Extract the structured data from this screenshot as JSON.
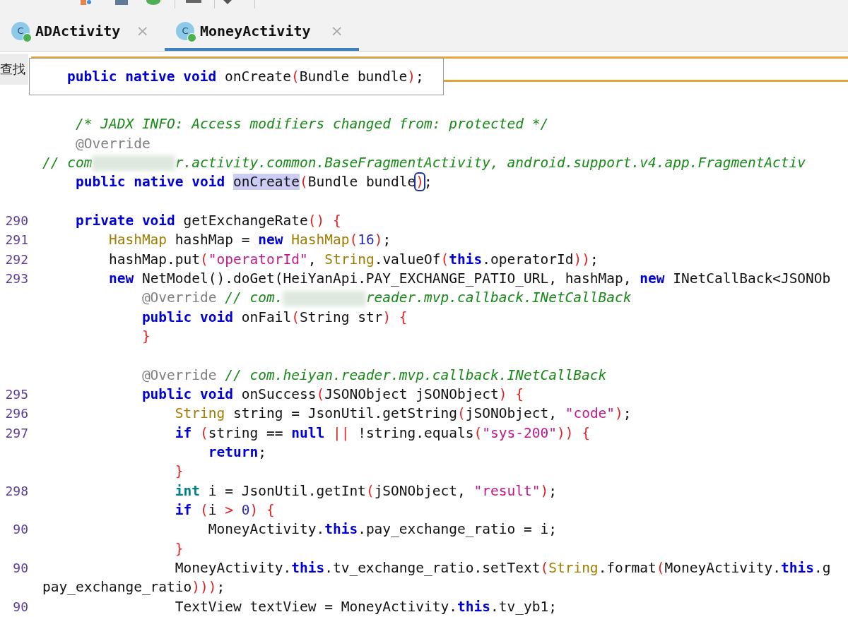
{
  "tabs": [
    {
      "label": "ADActivity",
      "icon_letter": "C",
      "close": "×",
      "selected": false
    },
    {
      "label": "MoneyActivity",
      "icon_letter": "C",
      "close": "×",
      "selected": true
    }
  ],
  "search": {
    "label": "查找"
  },
  "tooltip": {
    "tokens": [
      {
        "kind": "keyword",
        "text": "    public native void "
      },
      {
        "kind": "plain",
        "text": "onCreate"
      },
      {
        "kind": "punct",
        "text": "("
      },
      {
        "kind": "plain",
        "text": "Bundle bundle"
      },
      {
        "kind": "punct",
        "text": ")"
      },
      {
        "kind": "plain",
        "text": ";"
      }
    ]
  },
  "code_lines": [
    {
      "kind": "code",
      "tokens": [
        {
          "kind": "comment",
          "text": "    /* JADX INFO: Access modifiers changed from: protected */"
        }
      ]
    },
    {
      "kind": "code",
      "tokens": [
        {
          "kind": "annotation",
          "text": "    @Override"
        }
      ]
    },
    {
      "kind": "code",
      "tokens": [
        {
          "kind": "comment",
          "text": "// com"
        },
        {
          "kind": "redacted"
        },
        {
          "kind": "comment",
          "text": "r.activity.common.BaseFragmentActivity, android.support.v4.app.FragmentActiv"
        }
      ]
    },
    {
      "kind": "code",
      "tokens": [
        {
          "kind": "keyword",
          "text": "    public native void "
        },
        {
          "kind": "highlight",
          "text": "onCreate"
        },
        {
          "kind": "punct",
          "text": "("
        },
        {
          "kind": "plain",
          "text": "Bundle bundle"
        },
        {
          "kind": "matched",
          "text": ")"
        },
        {
          "kind": "plain",
          "text": ";"
        }
      ]
    },
    {
      "kind": "blank"
    },
    {
      "kind": "code",
      "number": "290",
      "tokens": [
        {
          "kind": "keyword",
          "text": "    private void "
        },
        {
          "kind": "plain",
          "text": "getExchangeRate"
        },
        {
          "kind": "punct",
          "text": "() {"
        }
      ]
    },
    {
      "kind": "code",
      "number": "291",
      "tokens": [
        {
          "kind": "type",
          "text": "        HashMap"
        },
        {
          "kind": "plain",
          "text": " hashMap = "
        },
        {
          "kind": "keyword",
          "text": "new "
        },
        {
          "kind": "type",
          "text": "HashMap"
        },
        {
          "kind": "punct",
          "text": "("
        },
        {
          "kind": "number",
          "text": "16"
        },
        {
          "kind": "punct",
          "text": ")"
        },
        {
          "kind": "plain",
          "text": ";"
        }
      ]
    },
    {
      "kind": "code",
      "number": "292",
      "tokens": [
        {
          "kind": "plain",
          "text": "        hashMap.put"
        },
        {
          "kind": "punct",
          "text": "("
        },
        {
          "kind": "string",
          "text": "\"operatorId\""
        },
        {
          "kind": "plain",
          "text": ", "
        },
        {
          "kind": "type",
          "text": "String"
        },
        {
          "kind": "plain",
          "text": ".valueOf"
        },
        {
          "kind": "punct",
          "text": "("
        },
        {
          "kind": "keyword",
          "text": "this"
        },
        {
          "kind": "plain",
          "text": ".operatorId"
        },
        {
          "kind": "punct",
          "text": "))"
        },
        {
          "kind": "plain",
          "text": ";"
        }
      ]
    },
    {
      "kind": "code",
      "number": "293",
      "tokens": [
        {
          "kind": "keyword",
          "text": "        new "
        },
        {
          "kind": "plain",
          "text": "NetModel().doGet(HeiYanApi.PAY_EXCHANGE_PATIO_URL, hashMap, "
        },
        {
          "kind": "keyword",
          "text": "new "
        },
        {
          "kind": "plain",
          "text": "INetCallBack<JSONOb"
        }
      ]
    },
    {
      "kind": "code",
      "tokens": [
        {
          "kind": "annotation",
          "text": "            @Override "
        },
        {
          "kind": "comment",
          "text": "// com."
        },
        {
          "kind": "redacted"
        },
        {
          "kind": "comment",
          "text": "reader.mvp.callback.INetCallBack"
        }
      ]
    },
    {
      "kind": "code",
      "tokens": [
        {
          "kind": "keyword",
          "text": "            public void "
        },
        {
          "kind": "plain",
          "text": "onFail"
        },
        {
          "kind": "punct",
          "text": "("
        },
        {
          "kind": "plain",
          "text": "String str"
        },
        {
          "kind": "punct",
          "text": ") {"
        }
      ]
    },
    {
      "kind": "code",
      "tokens": [
        {
          "kind": "punct",
          "text": "            }"
        }
      ]
    },
    {
      "kind": "blank"
    },
    {
      "kind": "code",
      "tokens": [
        {
          "kind": "annotation",
          "text": "            @Override "
        },
        {
          "kind": "comment",
          "text": "// com.heiyan.reader.mvp.callback.INetCallBack"
        }
      ]
    },
    {
      "kind": "code",
      "number": "295",
      "tokens": [
        {
          "kind": "keyword",
          "text": "            public void "
        },
        {
          "kind": "plain",
          "text": "onSuccess"
        },
        {
          "kind": "punct",
          "text": "("
        },
        {
          "kind": "plain",
          "text": "JSONObject jSONObject"
        },
        {
          "kind": "punct",
          "text": ") {"
        }
      ]
    },
    {
      "kind": "code",
      "number": "296",
      "tokens": [
        {
          "kind": "type",
          "text": "                String"
        },
        {
          "kind": "plain",
          "text": " string = JsonUtil.getString"
        },
        {
          "kind": "punct",
          "text": "("
        },
        {
          "kind": "plain",
          "text": "jSONObject, "
        },
        {
          "kind": "string",
          "text": "\"code\""
        },
        {
          "kind": "punct",
          "text": ")"
        },
        {
          "kind": "plain",
          "text": ";"
        }
      ]
    },
    {
      "kind": "code",
      "number": "297",
      "tokens": [
        {
          "kind": "keyword",
          "text": "                if "
        },
        {
          "kind": "punct",
          "text": "("
        },
        {
          "kind": "plain",
          "text": "string == "
        },
        {
          "kind": "keyword",
          "text": "null "
        },
        {
          "kind": "punct",
          "text": "||"
        },
        {
          "kind": "plain",
          "text": " !string.equals"
        },
        {
          "kind": "punct",
          "text": "("
        },
        {
          "kind": "string",
          "text": "\"sys-200\""
        },
        {
          "kind": "punct",
          "text": ")) {"
        }
      ]
    },
    {
      "kind": "code",
      "tokens": [
        {
          "kind": "keyword",
          "text": "                    return"
        },
        {
          "kind": "plain",
          "text": ";"
        }
      ]
    },
    {
      "kind": "code",
      "tokens": [
        {
          "kind": "punct",
          "text": "                }"
        }
      ]
    },
    {
      "kind": "code",
      "number": "298",
      "tokens": [
        {
          "kind": "keyword2",
          "text": "                int"
        },
        {
          "kind": "plain",
          "text": " i = JsonUtil.getInt"
        },
        {
          "kind": "punct",
          "text": "("
        },
        {
          "kind": "plain",
          "text": "jSONObject, "
        },
        {
          "kind": "string",
          "text": "\"result\""
        },
        {
          "kind": "punct",
          "text": ")"
        },
        {
          "kind": "plain",
          "text": ";"
        }
      ]
    },
    {
      "kind": "code",
      "tokens": [
        {
          "kind": "keyword",
          "text": "                if "
        },
        {
          "kind": "punct",
          "text": "("
        },
        {
          "kind": "plain",
          "text": "i "
        },
        {
          "kind": "punct",
          "text": "> "
        },
        {
          "kind": "number",
          "text": "0"
        },
        {
          "kind": "punct",
          "text": ") {"
        }
      ]
    },
    {
      "kind": "code",
      "number": "90",
      "tokens": [
        {
          "kind": "plain",
          "text": "                    MoneyActivity."
        },
        {
          "kind": "keyword",
          "text": "this"
        },
        {
          "kind": "plain",
          "text": ".pay_exchange_ratio = i;"
        }
      ]
    },
    {
      "kind": "code",
      "tokens": [
        {
          "kind": "punct",
          "text": "                }"
        }
      ]
    },
    {
      "kind": "code",
      "number": "90",
      "tokens": [
        {
          "kind": "plain",
          "text": "                MoneyActivity."
        },
        {
          "kind": "keyword",
          "text": "this"
        },
        {
          "kind": "plain",
          "text": ".tv_exchange_ratio.setText"
        },
        {
          "kind": "punct",
          "text": "("
        },
        {
          "kind": "type",
          "text": "String"
        },
        {
          "kind": "plain",
          "text": ".format"
        },
        {
          "kind": "punct",
          "text": "("
        },
        {
          "kind": "plain",
          "text": "MoneyActivity."
        },
        {
          "kind": "keyword",
          "text": "this"
        },
        {
          "kind": "plain",
          "text": ".g"
        }
      ]
    },
    {
      "kind": "code",
      "tokens": [
        {
          "kind": "plain",
          "text": "pay_exchange_ratio"
        },
        {
          "kind": "punct",
          "text": ")))"
        },
        {
          "kind": "plain",
          "text": ";"
        }
      ]
    },
    {
      "kind": "code",
      "number": "90",
      "tokens": [
        {
          "kind": "plain",
          "text": "                TextView textView = MoneyActivity."
        },
        {
          "kind": "keyword",
          "text": "this"
        },
        {
          "kind": "plain",
          "text": ".tv_yb1;"
        }
      ]
    }
  ]
}
